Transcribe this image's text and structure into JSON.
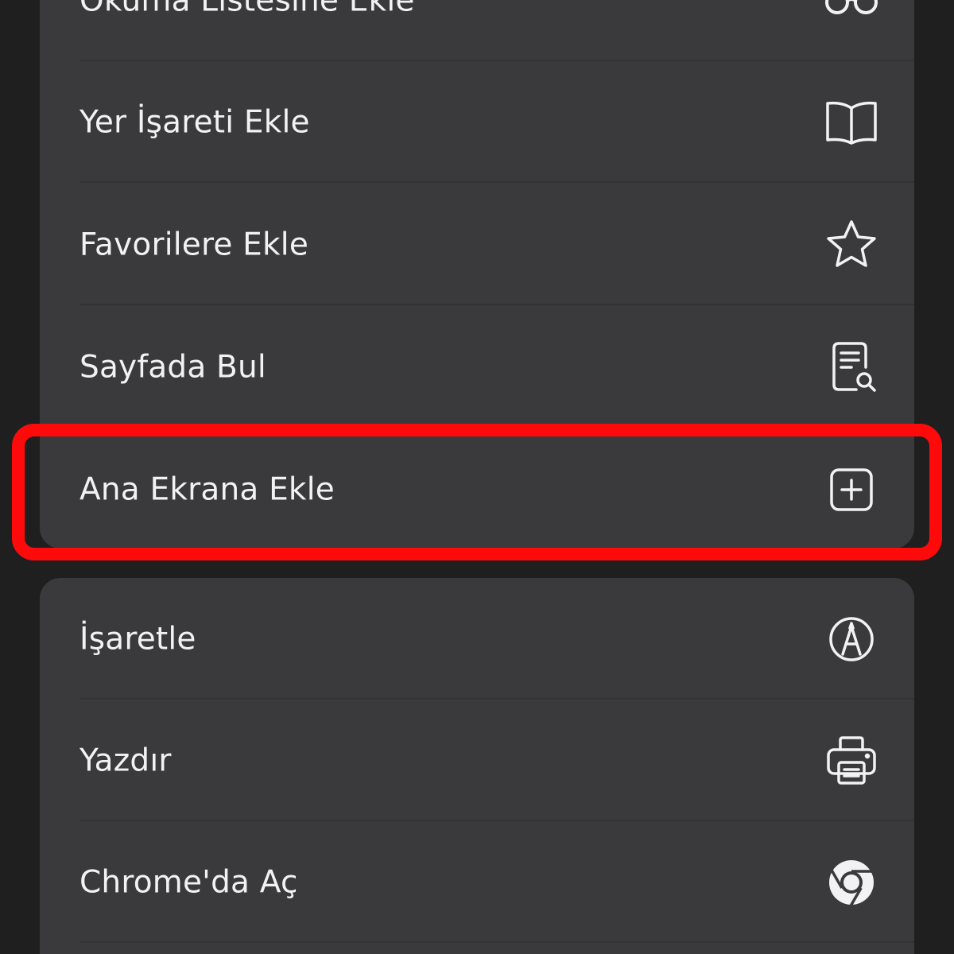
{
  "menu": {
    "group_top": [
      {
        "label": "Okuma Listesine Ekle",
        "icon": "glasses-icon"
      },
      {
        "label": "Yer İşareti Ekle",
        "icon": "book-icon"
      },
      {
        "label": "Favorilere Ekle",
        "icon": "star-icon"
      },
      {
        "label": "Sayfada Bul",
        "icon": "find-in-page-icon"
      },
      {
        "label": "Ana Ekrana Ekle",
        "icon": "add-square-icon"
      }
    ],
    "group_bottom": [
      {
        "label": "İşaretle",
        "icon": "markup-pen-icon"
      },
      {
        "label": "Yazdır",
        "icon": "printer-icon"
      },
      {
        "label": "Chrome'da Aç",
        "icon": "chrome-icon"
      }
    ]
  },
  "colors": {
    "background": "#1f1f20",
    "menu_surface": "#3a3a3c",
    "text": "#f2f2f4",
    "highlight": "#ff0a0a"
  }
}
